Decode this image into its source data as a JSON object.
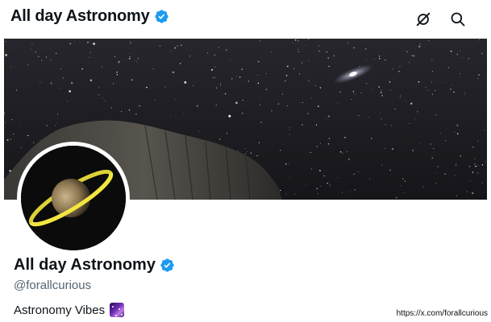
{
  "header": {
    "title": "All day Astronomy",
    "verified_icon": "verified-badge-icon",
    "actions": [
      {
        "icon": "no-signal-icon"
      },
      {
        "icon": "search-icon"
      }
    ]
  },
  "banner": {
    "description_icon": "night-sky-banner"
  },
  "profile": {
    "name": "All day Astronomy",
    "handle": "@forallcurious",
    "bio": "Astronomy Vibes"
  },
  "watermark": {
    "url": "https://x.com/forallcurious"
  },
  "colors": {
    "verified": "#1d9bf0",
    "text": "#0f1419",
    "secondary_text": "#536471"
  }
}
